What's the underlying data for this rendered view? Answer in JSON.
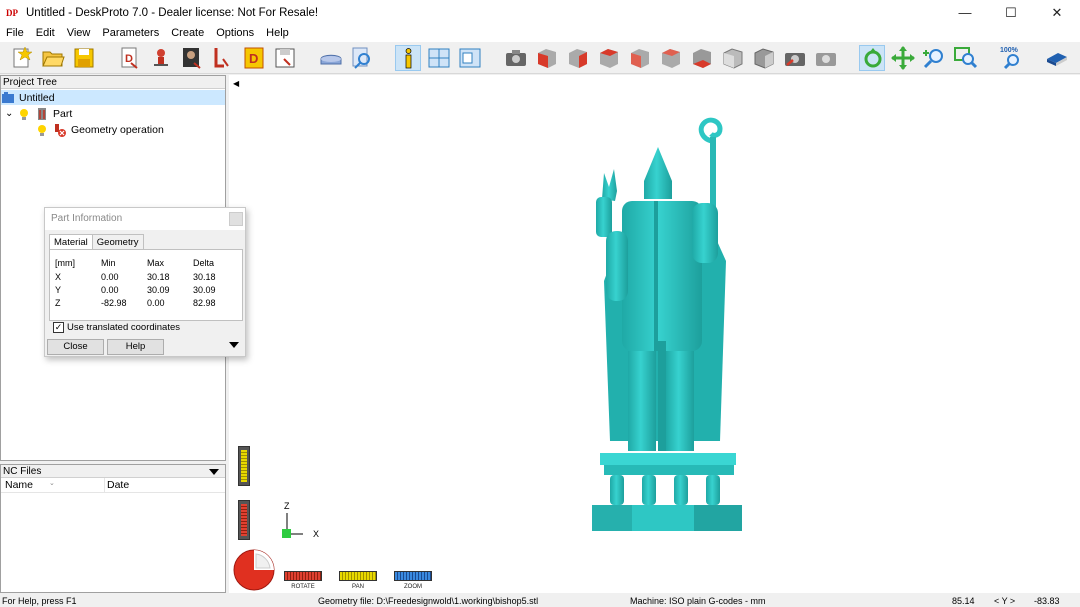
{
  "window": {
    "icon_text": "DP",
    "title": "Untitled - DeskProto 7.0 - Dealer license: Not For Resale!",
    "controls": {
      "minimize": "—",
      "maximize": "☐",
      "close": "✕"
    }
  },
  "menu": [
    "File",
    "Edit",
    "View",
    "Parameters",
    "Create",
    "Options",
    "Help"
  ],
  "toolbar": {
    "icons": [
      "new-project-icon",
      "open-icon",
      "save-icon",
      "import-geometry-icon",
      "import-vector-icon",
      "import-bitmap-icon",
      "export-icon",
      "delete-part-icon",
      "save-nc-icon",
      "select-icon",
      "inspect-icon",
      "info-icon",
      "layout-icon",
      "window-icon",
      "camera-icon",
      "view-front-icon",
      "view-back-icon",
      "view-left-icon",
      "view-right-icon",
      "view-top-icon",
      "view-bottom-icon",
      "view-iso-icon",
      "view-iso2-icon",
      "undo-view-icon",
      "redo-view-icon",
      "rotate-icon",
      "pan-icon",
      "zoom-icon",
      "zoom-window-icon",
      "zoom-100-icon",
      "book-icon"
    ],
    "zoom_label": "100%"
  },
  "project_tree": {
    "header": "Project Tree",
    "items": [
      {
        "label": "Untitled",
        "selected": true
      },
      {
        "label": "Part",
        "expander": "⌄"
      },
      {
        "label": "Geometry operation"
      }
    ]
  },
  "nc_files": {
    "header": "NC Files",
    "columns": [
      "Name",
      "Date"
    ]
  },
  "part_info": {
    "title": "Part Information",
    "tabs": [
      "Material",
      "Geometry"
    ],
    "headers": [
      "[mm]",
      "Min",
      "Max",
      "Delta"
    ],
    "rows": [
      [
        "X",
        "0.00",
        "30.18",
        "30.18"
      ],
      [
        "Y",
        "0.00",
        "30.09",
        "30.09"
      ],
      [
        "Z",
        "-82.98",
        "0.00",
        "82.98"
      ]
    ],
    "checkbox_label": "Use translated coordinates",
    "checkbox_checked": "✓",
    "close_label": "Close",
    "help_label": "Help"
  },
  "axes": {
    "z": "Z",
    "x": "X"
  },
  "controls": {
    "rotate": "ROTATE",
    "pan": "PAN",
    "zoom": "ZOOM"
  },
  "status": {
    "help": "For Help, press F1",
    "geometry": "Geometry file: D:\\Freedesignwold\\1.working\\bishop5.stl",
    "machine": "Machine: ISO plain G-codes - mm",
    "x": "85.14",
    "y_label": "< Y >",
    "y": "-83.83"
  },
  "colors": {
    "model": "#2ec7c4",
    "model_shadow": "#1a8f8d",
    "selected": "#cce8ff"
  }
}
